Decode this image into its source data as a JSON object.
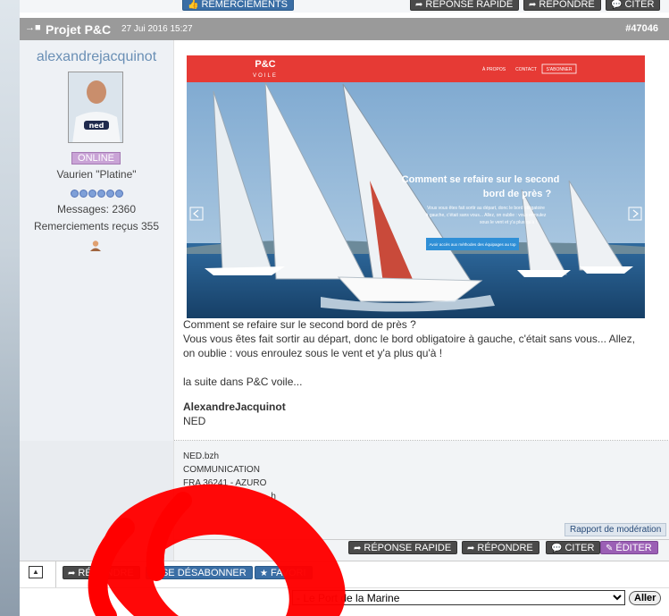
{
  "colors": {
    "header_bg": "#9a9a9a",
    "author_name": "#6a8fb5",
    "online_badge": "#c9a3d6",
    "button_gray": "#4a4a4a",
    "button_blue": "#3a6ea5",
    "button_purple": "#9b5fb5",
    "annotation_red": "#ff0000"
  },
  "topbar": {
    "thanks_label": "REMERCIEMENTS",
    "quick_reply_label": "RÉPONSE RAPIDE",
    "reply_label": "RÉPONDRE",
    "quote_label": "CITER"
  },
  "post": {
    "title": "Projet P&C",
    "date": "27 Jui 2016 15:27",
    "number": "#47046",
    "author": {
      "name": "alexandrejacquinot",
      "status": "ONLINE",
      "rank": "Vaurien \"Platine\"",
      "rank_dots": 6,
      "messages": "Messages: 2360",
      "thanks": "Remerciements reçus 355",
      "user_icon": "user-icon"
    },
    "hero": {
      "brand_line1": "P&C",
      "brand_line2": "VOILE",
      "nav_about": "À PROPOS",
      "nav_contact": "CONTACT",
      "nav_subscribe": "S'ABONNER",
      "headline_line1": "Comment se refaire sur le second",
      "headline_line2": "bord de près ?",
      "body_line1": "Vous vous êtes fait sortir au départ, donc le bord obligatoire",
      "body_line2": "à gauche, c'était sans vous... Allez, on oublie : vous enroulez",
      "body_line3": "sous le vent et y'a plus qu'à !",
      "cta": "Avoir accès aux méthodes des équipages au top",
      "prev_icon": "chevron-left-icon",
      "next_icon": "chevron-right-icon"
    },
    "text": {
      "line1": "Comment se refaire sur le second bord de près ?",
      "line2": "Vous vous êtes fait sortir au départ, donc le bord obligatoire à gauche, c'était sans vous... Allez,",
      "line3": "on oublie : vous enroulez sous le vent et y'a plus qu'à !",
      "line4": "la suite dans P&C voile...",
      "sign_name": "AlexandreJacquinot",
      "sign_org": "NED"
    },
    "signature": {
      "line1": "NED.bzh",
      "line2": "COMMUNICATION",
      "line3": "FRA 36241 - AZURO",
      "line4": "...h"
    },
    "moderation_label": "Rapport de modération",
    "actions": {
      "quick_reply": "RÉPONSE RAPIDE",
      "reply": "RÉPONDRE",
      "quote": "CITER",
      "edit": "ÉDITER"
    }
  },
  "footer": {
    "scroll_up_icon": "arrow-up-icon",
    "reply_label": "RÉPONDRE",
    "unsubscribe_label": "SE DÉSABONNER",
    "favorite_label": "FAVORI",
    "jump_select_value": "- Le Port de la Marine",
    "go_label": "Aller"
  }
}
